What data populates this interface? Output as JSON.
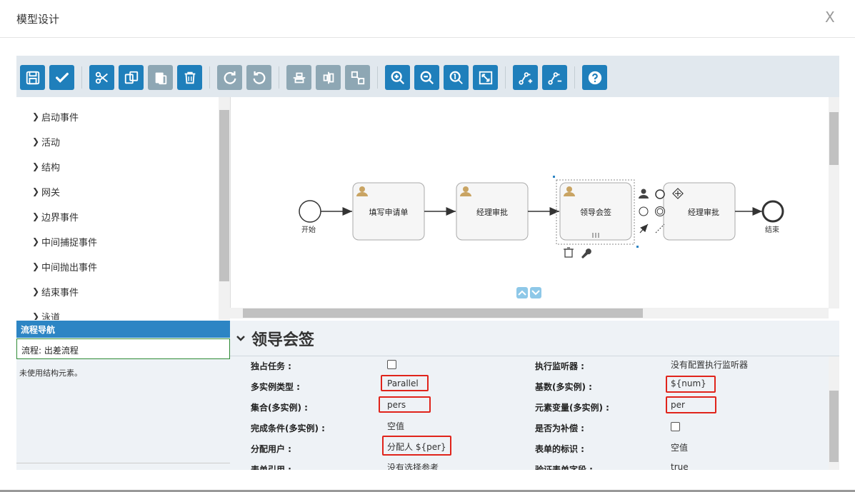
{
  "dialog": {
    "title": "模型设计",
    "close": "X"
  },
  "toolbar": {
    "buttons": [
      {
        "name": "save",
        "icon": "save-icon"
      },
      {
        "name": "validate",
        "icon": "check-icon"
      },
      {
        "name": "cut",
        "icon": "scissors-icon"
      },
      {
        "name": "copy",
        "icon": "copy-icon"
      },
      {
        "name": "paste",
        "icon": "paste-icon"
      },
      {
        "name": "delete",
        "icon": "trash-icon"
      },
      {
        "name": "redo",
        "icon": "redo-icon"
      },
      {
        "name": "undo",
        "icon": "undo-icon"
      },
      {
        "name": "align-horizontal",
        "icon": "align-horizontal-icon"
      },
      {
        "name": "align-vertical",
        "icon": "align-vertical-icon"
      },
      {
        "name": "same-size",
        "icon": "same-size-icon"
      },
      {
        "name": "zoom-in",
        "icon": "zoom-in-icon"
      },
      {
        "name": "zoom-out",
        "icon": "zoom-out-icon"
      },
      {
        "name": "zoom-actual",
        "icon": "zoom-actual-icon"
      },
      {
        "name": "zoom-fit",
        "icon": "zoom-fit-icon"
      },
      {
        "name": "add-bendpoint",
        "icon": "add-bendpoint-icon"
      },
      {
        "name": "remove-bendpoint",
        "icon": "remove-bendpoint-icon"
      },
      {
        "name": "help",
        "icon": "help-icon"
      }
    ],
    "colors": {
      "active": "#1f7fbb",
      "disabled": "#8ea7b4"
    }
  },
  "palette": {
    "items": [
      "启动事件",
      "活动",
      "结构",
      "网关",
      "边界事件",
      "中间捕捉事件",
      "中间抛出事件",
      "结束事件",
      "泳道"
    ]
  },
  "navigator": {
    "header": "流程导航",
    "flow": "流程: 出差流程",
    "note": "未使用结构元素。"
  },
  "diagram": {
    "start_label": "开始",
    "end_label": "结束",
    "tasks": [
      "填写申请单",
      "经理审批",
      "领导会签",
      "经理审批"
    ]
  },
  "properties": {
    "title": "领导会签",
    "rows": [
      {
        "label": "独占任务 :",
        "value": ""
      },
      {
        "label": "多实例类型 :",
        "value": "Parallel"
      },
      {
        "label": "集合(多实例) :",
        "value": "pers"
      },
      {
        "label": "完成条件(多实例) :",
        "value": "空值"
      },
      {
        "label": "分配用户 :",
        "value": "分配人 ${per}"
      },
      {
        "label": "表单引用 :",
        "value": "没有选择参考"
      }
    ],
    "rows_right": [
      {
        "label": "执行监听器 :",
        "value": "没有配置执行监听器"
      },
      {
        "label": "基数(多实例) :",
        "value": "${num}"
      },
      {
        "label": "元素变量(多实例) :",
        "value": "per"
      },
      {
        "label": "是否为补偿 :",
        "value": ""
      },
      {
        "label": "表单的标识 :",
        "value": "空值"
      },
      {
        "label": "验证表单字段 :",
        "value": "true"
      }
    ],
    "highlight_color": "#e0241b"
  }
}
